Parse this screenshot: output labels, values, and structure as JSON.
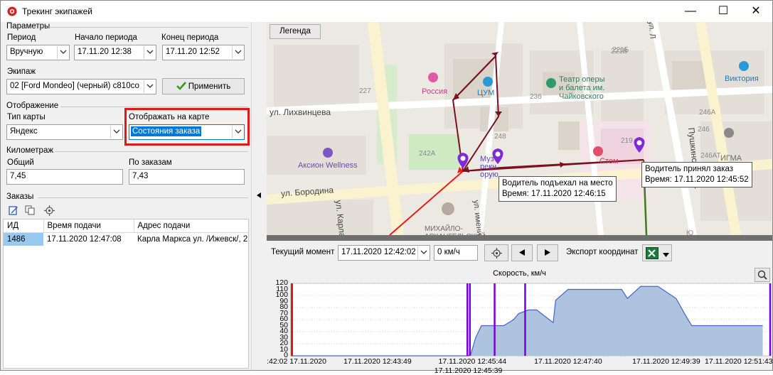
{
  "window": {
    "title": "Трекинг экипажей",
    "minimize": "—",
    "maximize": "☐",
    "close": "✕"
  },
  "params": {
    "group_label": "Параметры",
    "period_label": "Период",
    "period_value": "Вручную",
    "start_label": "Начало периода",
    "start_value": "17.11.20 12:38",
    "end_label": "Конец периода",
    "end_value": "17.11.20 12:52",
    "crew_label": "Экипаж",
    "crew_value": "02 [Ford Mondeo] (черный) с810со",
    "apply_label": "Применить"
  },
  "display": {
    "group_label": "Отображение",
    "map_type_label": "Тип карты",
    "map_type_value": "Яндекс",
    "show_label": "Отображать на карте",
    "show_value": "Состояния заказа"
  },
  "mileage": {
    "group_label": "Километраж",
    "total_label": "Общий",
    "total_value": "7,45",
    "orders_label": "По заказам",
    "orders_value": "7,43"
  },
  "orders": {
    "group_label": "Заказы",
    "columns": [
      "ИД",
      "Время подачи",
      "Адрес подачи"
    ],
    "rows": [
      [
        "1486",
        "17.11.2020 12:47:08",
        "Карла Маркса ул. /Ижевск/, 2"
      ]
    ]
  },
  "map": {
    "legend_button": "Легенда",
    "popup1_title": "Водитель подъехал на место",
    "popup1_time": "Время: 17.11.2020 12:46:15",
    "popup2_title": "Водитель принял заказ",
    "popup2_time": "Время: 17.11.2020 12:45:52",
    "places": {
      "rossiya": "Россия",
      "tsum": "ЦУМ",
      "theatre": "Театр оперы\nи балета им.\nЧайковского",
      "victoria": "Виктория",
      "aksion": "Аксион Wellness",
      "igma": "ИГМА",
      "muzey": "Муз\nрекн\nорую",
      "stom": "Стом",
      "mikhailo": "МИХАЙЛО-\nАРХАНГЕЛЬСКИЙ",
      "streets": {
        "likhvintseva": "ул. Лихвинцева",
        "borodina": "ул. Бородина",
        "karla_marksa": "ул. Карла Маркса",
        "pushkinskaya": "Пушкинская ул.",
        "imeni": "ул. имени В",
        "lenina": "ул. Л"
      },
      "numbers": [
        "221Б",
        "221В",
        "227",
        "236",
        "248",
        "242А",
        "219",
        "246А",
        "246",
        "246АТ",
        "Ю"
      ]
    }
  },
  "toolbar": {
    "moment_label": "Текущий момент",
    "moment_value": "17.11.2020 12:42:02",
    "speed_value": "0 км/ч",
    "export_label": "Экспорт координат"
  },
  "colors": {
    "track": "#7a1020",
    "red_track": "#e81b1b",
    "green_track": "#3d7a1c",
    "marker": "#7f2ad6",
    "highlight": "#e01818",
    "area_fill": "#adc3de",
    "area_line": "#4a62c8",
    "event_line": "#7a00d6"
  },
  "chart_data": {
    "type": "area",
    "title": "Скорость, км/ч",
    "ylim": [
      0,
      120
    ],
    "yticks": [
      0,
      10,
      20,
      30,
      40,
      50,
      60,
      70,
      80,
      90,
      100,
      110,
      120
    ],
    "xlim": [
      "12:42:02",
      "12:51:43"
    ],
    "xtick_labels": [
      "17.11.2020 12:42:02",
      "17.11.2020 12:43:49",
      "17.11.2020 12:45:39",
      "17.11.2020 12:45:44",
      "17.11.2020 12:47:40",
      "17.11.2020 12:49:39",
      "17.11.2020 12:51:43"
    ],
    "x": [
      "12:42:02",
      "12:45:37",
      "12:45:40",
      "12:45:46",
      "12:45:53",
      "12:46:20",
      "12:46:32",
      "12:46:38",
      "12:46:50",
      "12:47:00",
      "12:47:20",
      "12:47:23",
      "12:47:38",
      "12:48:13",
      "12:48:43",
      "12:48:50",
      "12:49:06",
      "12:49:27",
      "12:49:49",
      "12:50:00",
      "12:50:08",
      "12:50:15",
      "12:51:34"
    ],
    "values": [
      0,
      0,
      2,
      30,
      50,
      50,
      60,
      70,
      76,
      76,
      55,
      92,
      110,
      110,
      110,
      95,
      115,
      115,
      95,
      68,
      50,
      50,
      50
    ],
    "events": {
      "red": [
        "12:42:02"
      ],
      "purple": [
        "12:45:36",
        "12:45:39",
        "12:46:09",
        "12:46:46",
        "12:51:43"
      ]
    }
  }
}
